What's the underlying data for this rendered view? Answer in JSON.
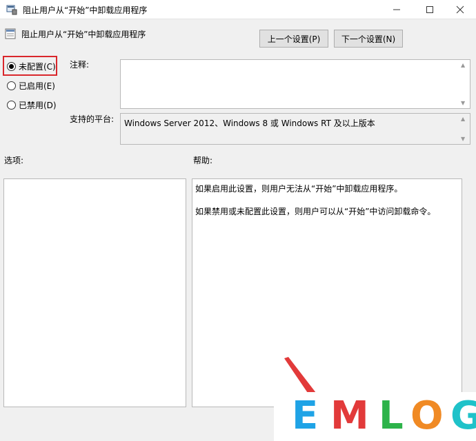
{
  "window": {
    "title": "阻止用户从“开始”中卸载应用程序",
    "header_title": "阻止用户从“开始”中卸载应用程序"
  },
  "nav": {
    "prev_label": "上一个设置(P)",
    "next_label": "下一个设置(N)"
  },
  "state": {
    "options": [
      {
        "label": "未配置(C)",
        "checked": true
      },
      {
        "label": "已启用(E)",
        "checked": false
      },
      {
        "label": "已禁用(D)",
        "checked": false
      }
    ]
  },
  "labels": {
    "comment": "注释:",
    "platform": "支持的平台:",
    "options": "选项:",
    "help": "帮助:"
  },
  "comment_value": "",
  "platform_value": "Windows Server 2012、Windows 8 或 Windows RT 及以上版本",
  "help_text": [
    "如果启用此设置，则用户无法从“开始”中卸载应用程序。",
    "如果禁用或未配置此设置，则用户可以从“开始”中访问卸载命令。"
  ],
  "watermark": {
    "letters": [
      "E",
      "M",
      "L",
      "O",
      "G"
    ],
    "colors": [
      "#1fa3e6",
      "#e23a3a",
      "#2db34a",
      "#f08a24",
      "#1fc2c9"
    ]
  },
  "colors": {
    "highlight": "#d9262b"
  },
  "icons": {
    "app": "policy-icon",
    "minimize": "minimize-icon",
    "maximize": "maximize-icon",
    "close": "close-icon"
  }
}
